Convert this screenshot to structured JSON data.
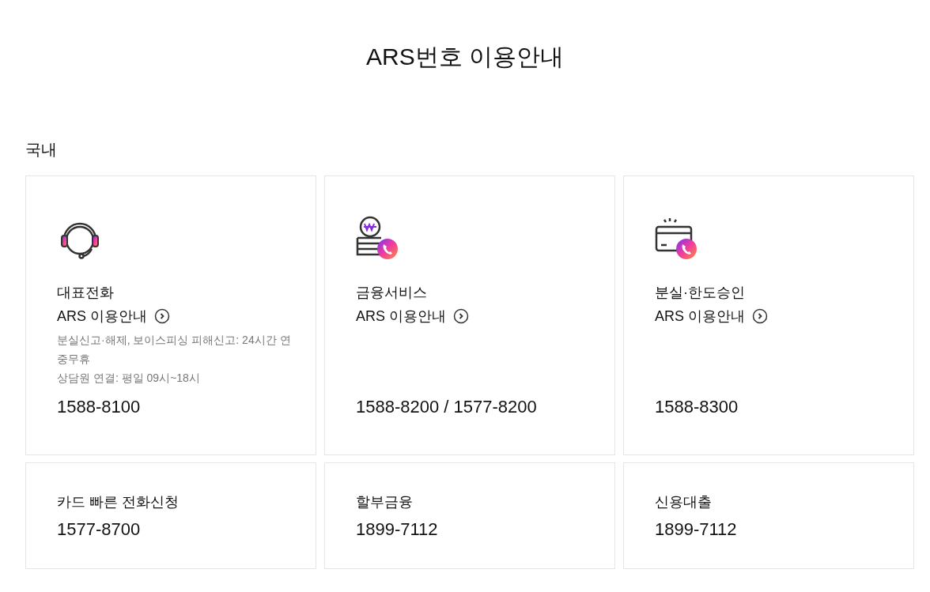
{
  "title": "ARS번호 이용안내",
  "section_title": "국내",
  "main_cards": [
    {
      "kind": "headset",
      "title": "대표전화",
      "link": "ARS 이용안내",
      "description": [
        "분실신고·해제, 보이스피싱 피해신고: 24시간 연중무휴",
        "상담원 연결: 평일 09시~18시"
      ],
      "phone": "1588-8100"
    },
    {
      "kind": "coin",
      "title": "금융서비스",
      "link": "ARS 이용안내",
      "phone": "1588-8200 / 1577-8200"
    },
    {
      "kind": "card",
      "title": "분실·한도승인",
      "link": "ARS 이용안내",
      "phone": "1588-8300"
    }
  ],
  "small_cards": [
    {
      "title": "카드 빠른 전화신청",
      "phone": "1577-8700"
    },
    {
      "title": "할부금융",
      "phone": "1899-7112"
    },
    {
      "title": "신용대출",
      "phone": "1899-7112"
    }
  ]
}
